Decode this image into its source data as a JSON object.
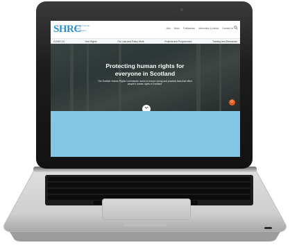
{
  "site": {
    "logo_letters": "SHRC",
    "logo_subtitle": "Scottish Human Rights Commission",
    "utility_nav": [
      "Jobs",
      "News",
      "Publications",
      "Information & Advice",
      "Contact Us"
    ],
    "main_nav": [
      "COVID-19",
      "Your Rights",
      "Our Law and Policy Work",
      "Projects and Programmes",
      "Training and Resources"
    ],
    "hero_title": "Protecting human rights for everyone in Scotland",
    "hero_subtitle": "The Scottish Human Rights Commission works to ensure strong and practical laws that effect people's human rights in Scotland."
  },
  "colors": {
    "brand": "#2c8fcf",
    "screen_background": "#84c6e6",
    "accessibility_button": "#e25d1e"
  },
  "icons": {
    "search": "search-icon",
    "accessibility": "accessibility-icon",
    "scroll_down": "chevron-down-icon"
  }
}
